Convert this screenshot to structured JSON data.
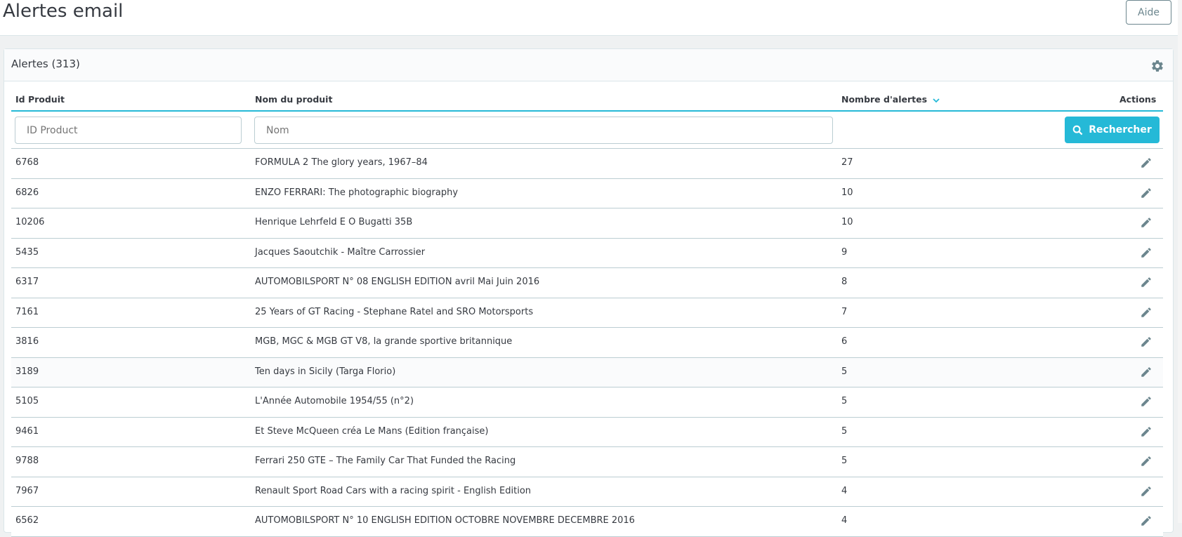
{
  "header": {
    "title": "Alertes email",
    "help_label": "Aide"
  },
  "card": {
    "title": "Alertes (313)"
  },
  "table": {
    "columns": {
      "id": "Id Produit",
      "name": "Nom du produit",
      "count": "Nombre d'alertes",
      "actions": "Actions"
    },
    "filters": {
      "id_placeholder": "ID Product",
      "name_placeholder": "Nom",
      "search_label": "Rechercher"
    },
    "rows": [
      {
        "id": "6768",
        "name": "FORMULA 2 The glory years, 1967–84",
        "count": "27"
      },
      {
        "id": "6826",
        "name": "ENZO FERRARI: The photographic biography",
        "count": "10"
      },
      {
        "id": "10206",
        "name": "Henrique Lehrfeld E O Bugatti 35B",
        "count": "10"
      },
      {
        "id": "5435",
        "name": "Jacques Saoutchik - Maître Carrossier",
        "count": "9"
      },
      {
        "id": "6317",
        "name": "AUTOMOBILSPORT N° 08 ENGLISH EDITION avril Mai Juin 2016",
        "count": "8"
      },
      {
        "id": "7161",
        "name": "25 Years of GT Racing - Stephane Ratel and SRO Motorsports",
        "count": "7"
      },
      {
        "id": "3816",
        "name": "MGB, MGC & MGB GT V8, la grande sportive britannique",
        "count": "6"
      },
      {
        "id": "3189",
        "name": "Ten days in Sicily (Targa Florio)",
        "count": "5"
      },
      {
        "id": "5105",
        "name": "L'Année Automobile 1954/55 (n°2)",
        "count": "5"
      },
      {
        "id": "9461",
        "name": "Et Steve McQueen créa Le Mans (Edition française)",
        "count": "5"
      },
      {
        "id": "9788",
        "name": "Ferrari 250 GTE – The Family Car That Funded the Racing",
        "count": "5"
      },
      {
        "id": "7967",
        "name": "Renault Sport Road Cars with a racing spirit - English Edition",
        "count": "4"
      },
      {
        "id": "6562",
        "name": "AUTOMOBILSPORT N° 10 ENGLISH EDITION OCTOBRE NOVEMBRE DECEMBRE 2016",
        "count": "4"
      }
    ]
  },
  "colors": {
    "accent": "#25b9d7",
    "text": "#363a41",
    "border": "#bbcdd2"
  }
}
